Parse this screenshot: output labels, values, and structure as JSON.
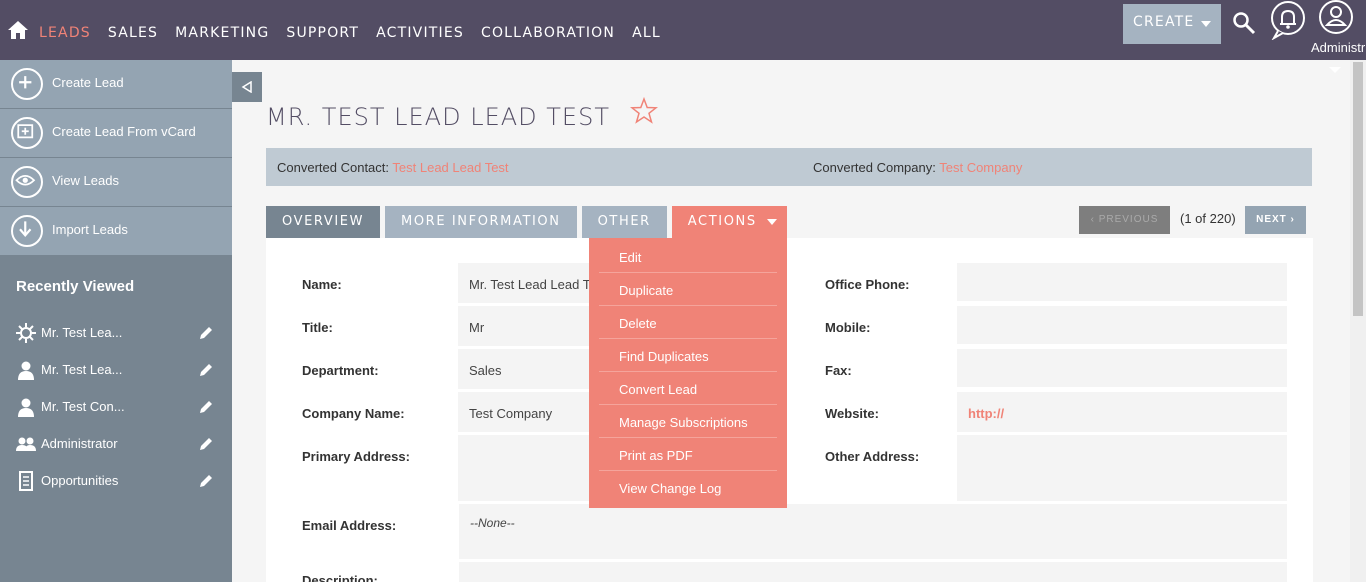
{
  "nav": {
    "items": [
      "LEADS",
      "SALES",
      "MARKETING",
      "SUPPORT",
      "ACTIVITIES",
      "COLLABORATION",
      "ALL"
    ],
    "create_label": "CREATE",
    "user_label": "Administr"
  },
  "sidebar": {
    "actions": [
      "Create Lead",
      "Create Lead From vCard",
      "View Leads",
      "Import Leads"
    ],
    "recent_title": "Recently Viewed",
    "recent": [
      "Mr. Test Lea...",
      "Mr. Test Lea...",
      "Mr. Test Con...",
      "Administrator",
      "Opportunities"
    ]
  },
  "record": {
    "title": "MR. TEST LEAD LEAD TEST",
    "converted_contact_label": "Converted Contact:",
    "converted_contact_value": "Test Lead Lead Test",
    "converted_company_label": "Converted Company:",
    "converted_company_value": "Test Company"
  },
  "tabs": [
    "OVERVIEW",
    "MORE INFORMATION",
    "OTHER",
    "ACTIONS"
  ],
  "pager": {
    "prev": "PREVIOUS",
    "count": "(1 of 220)",
    "next": "NEXT"
  },
  "fields": {
    "name_label": "Name:",
    "name_value": "Mr. Test Lead Lead Test",
    "title_label": "Title:",
    "title_value": "Mr",
    "department_label": "Department:",
    "department_value": "Sales",
    "company_label": "Company Name:",
    "company_value": "Test Company",
    "primary_address_label": "Primary Address:",
    "email_label": "Email Address:",
    "email_value": "--None--",
    "description_label": "Description:",
    "office_phone_label": "Office Phone:",
    "mobile_label": "Mobile:",
    "fax_label": "Fax:",
    "website_label": "Website:",
    "website_value": "http://",
    "other_address_label": "Other Address:"
  },
  "actions_menu": [
    "Edit",
    "Duplicate",
    "Delete",
    "Find Duplicates",
    "Convert Lead",
    "Manage Subscriptions",
    "Print as PDF",
    "View Change Log"
  ],
  "colors": {
    "accent": "#f08377",
    "topbar": "#534d64",
    "sidebar": "#778591"
  }
}
